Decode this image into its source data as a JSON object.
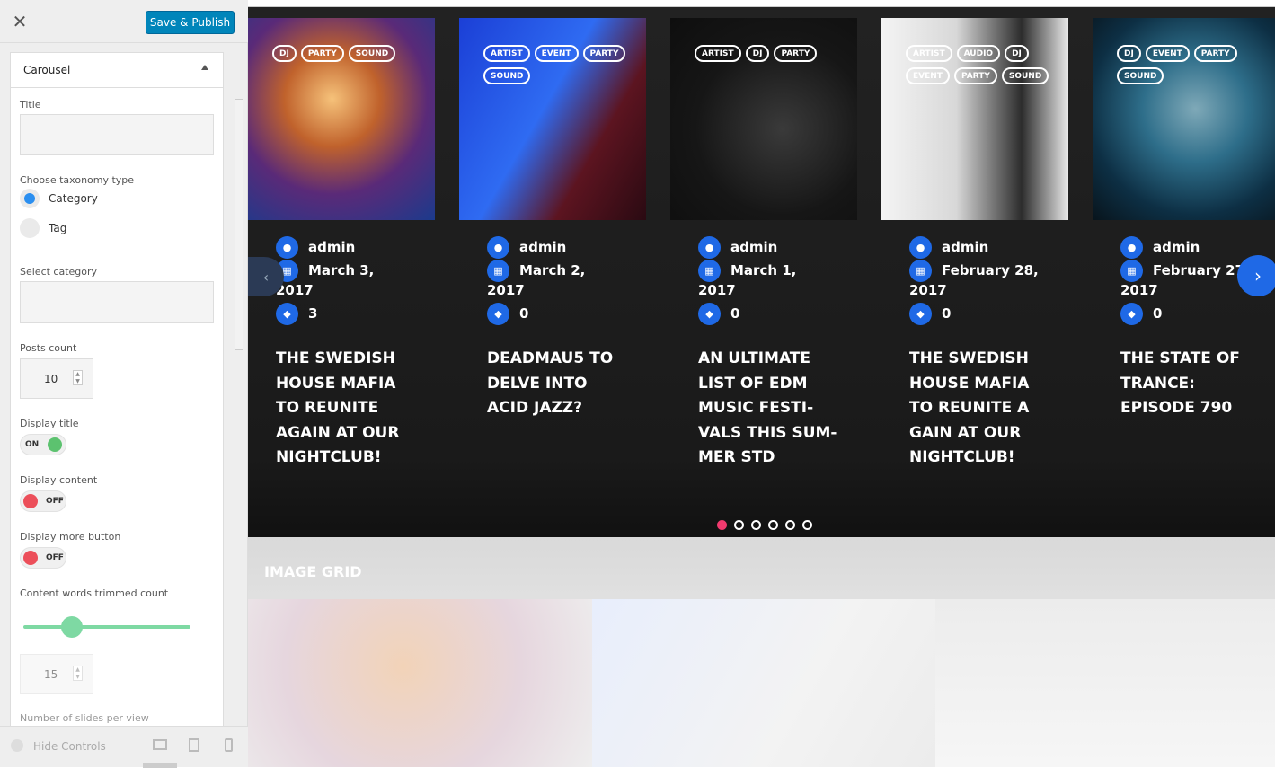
{
  "topbar": {
    "close_label": "✕",
    "save_label": "Save & Publish"
  },
  "panel": {
    "title": "Carousel",
    "title_field_label": "Title",
    "title_value": "",
    "taxonomy_label": "Choose taxonomy type",
    "taxonomy_options": [
      {
        "label": "Category",
        "selected": true
      },
      {
        "label": "Tag",
        "selected": false
      }
    ],
    "select_category_label": "Select category",
    "posts_count_label": "Posts count",
    "posts_count": "10",
    "display_title_label": "Display title",
    "display_title": "ON",
    "display_content_label": "Display content",
    "display_content": "OFF",
    "display_more_label": "Display more button",
    "display_more": "OFF",
    "trim_label": "Content words trimmed count",
    "trim_value": "15",
    "slides_label": "Number of slides per view"
  },
  "footer": {
    "hide_controls": "Hide Controls"
  },
  "colors": {
    "accent": "#1f69e6",
    "toggle_on": "#5cc26f",
    "toggle_off": "#ec4f5a",
    "dot_active": "#f03a6e",
    "save": "#0085ba"
  },
  "carousel": {
    "cards": [
      {
        "tags": [
          "DJ",
          "PARTY",
          "SOUND"
        ],
        "author": "admin",
        "date": "March 3,",
        "year": "2017",
        "comments": "3",
        "title": [
          "THE SWEDISH",
          "HOUSE MAFIA",
          "TO REUNITE",
          "AGAIN AT OUR",
          "NIGHTCLUB!"
        ]
      },
      {
        "tags": [
          "ARTIST",
          "EVENT",
          "PARTY",
          "SOUND"
        ],
        "author": "admin",
        "date": "March 2,",
        "year": "2017",
        "comments": "0",
        "title": [
          "DEADMAU5 TO",
          "DELVE INTO",
          "ACID JAZZ?"
        ]
      },
      {
        "tags": [
          "ARTIST",
          "DJ",
          "PARTY"
        ],
        "author": "admin",
        "date": "March 1,",
        "year": "2017",
        "comments": "0",
        "title": [
          "AN ULTIMATE",
          "LIST OF EDM",
          "MUSIC FESTI-",
          "VALS THIS SUM-",
          "MER STD"
        ]
      },
      {
        "tags": [
          "ARTIST",
          "AUDIO",
          "DJ",
          "EVENT",
          "PARTY",
          "SOUND"
        ],
        "author": "admin",
        "date": "February 28,",
        "year": "2017",
        "comments": "0",
        "title": [
          "THE SWEDISH",
          "HOUSE MAFIA",
          "TO REUNITE A",
          "GAIN AT OUR",
          "NIGHTCLUB!"
        ]
      },
      {
        "tags": [
          "DJ",
          "EVENT",
          "PARTY",
          "SOUND"
        ],
        "author": "admin",
        "date": "February 27,",
        "year": "2017",
        "comments": "0",
        "title": [
          "THE STATE OF",
          "TRANCE:",
          "EPISODE 790"
        ]
      }
    ],
    "pages": 6,
    "active_page": 0
  },
  "grid": {
    "title": "IMAGE GRID"
  }
}
